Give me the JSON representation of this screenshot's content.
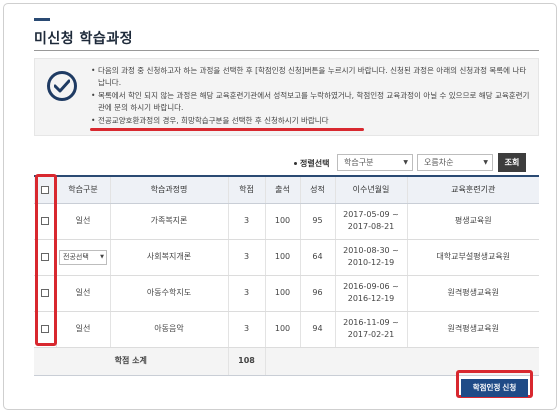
{
  "page": {
    "title": "미신청 학습과정"
  },
  "notice": {
    "icon": "check-circle-icon",
    "items": [
      "다음의 과정 중 신청하고자 하는 과정을 선택한 후 [학점인정 신청]버튼을 누르시기 바랍니다. 신청된 과정은 아래의 신청과정 목록에 나타납니다.",
      "목록에서 학인 되지 않는 과정은 해당 교육훈련기관에서 성적보고를 누락하였거나, 학점인정 교육과정이 아닐 수 있으므로 해당 교육훈련기관에 문의 하시기 바랍니다.",
      "전공교양호환과정의 경우, 희망학습구분을 선택한 후 신청하시기 바랍니다"
    ]
  },
  "sort": {
    "label": "정렬선택",
    "field_value": "학습구분",
    "order_value": "오름차순",
    "search_label": "조회"
  },
  "table": {
    "headers": [
      "",
      "학습구분",
      "학습과정명",
      "학점",
      "출석",
      "성적",
      "이수년월일",
      "교육훈련기관"
    ],
    "rows": [
      {
        "type": "일선",
        "course": "가족복지론",
        "credit": "3",
        "attendance": "100",
        "score": "95",
        "date_start": "2017-05-09 ~",
        "date_end": "2017-08-21",
        "institution": "평생교육원"
      },
      {
        "type": "전공선택",
        "course": "사회복지개론",
        "credit": "3",
        "attendance": "100",
        "score": "64",
        "date_start": "2010-08-30 ~",
        "date_end": "2010-12-19",
        "institution": "대학교부설평생교육원"
      },
      {
        "type": "일선",
        "course": "아동수학지도",
        "credit": "3",
        "attendance": "100",
        "score": "96",
        "date_start": "2016-09-06 ~",
        "date_end": "2016-12-19",
        "institution": "원격평생교육원"
      },
      {
        "type": "일선",
        "course": "아동음악",
        "credit": "3",
        "attendance": "100",
        "score": "94",
        "date_start": "2016-11-09 ~",
        "date_end": "2017-02-21",
        "institution": "원격평생교육원"
      }
    ],
    "summary": {
      "label": "학점 소계",
      "total": "108"
    }
  },
  "actions": {
    "apply_label": "학점인정 신청"
  },
  "colors": {
    "accent": "#1f4b87",
    "highlight": "#d8282f",
    "header_bg": "#eef1f6"
  }
}
